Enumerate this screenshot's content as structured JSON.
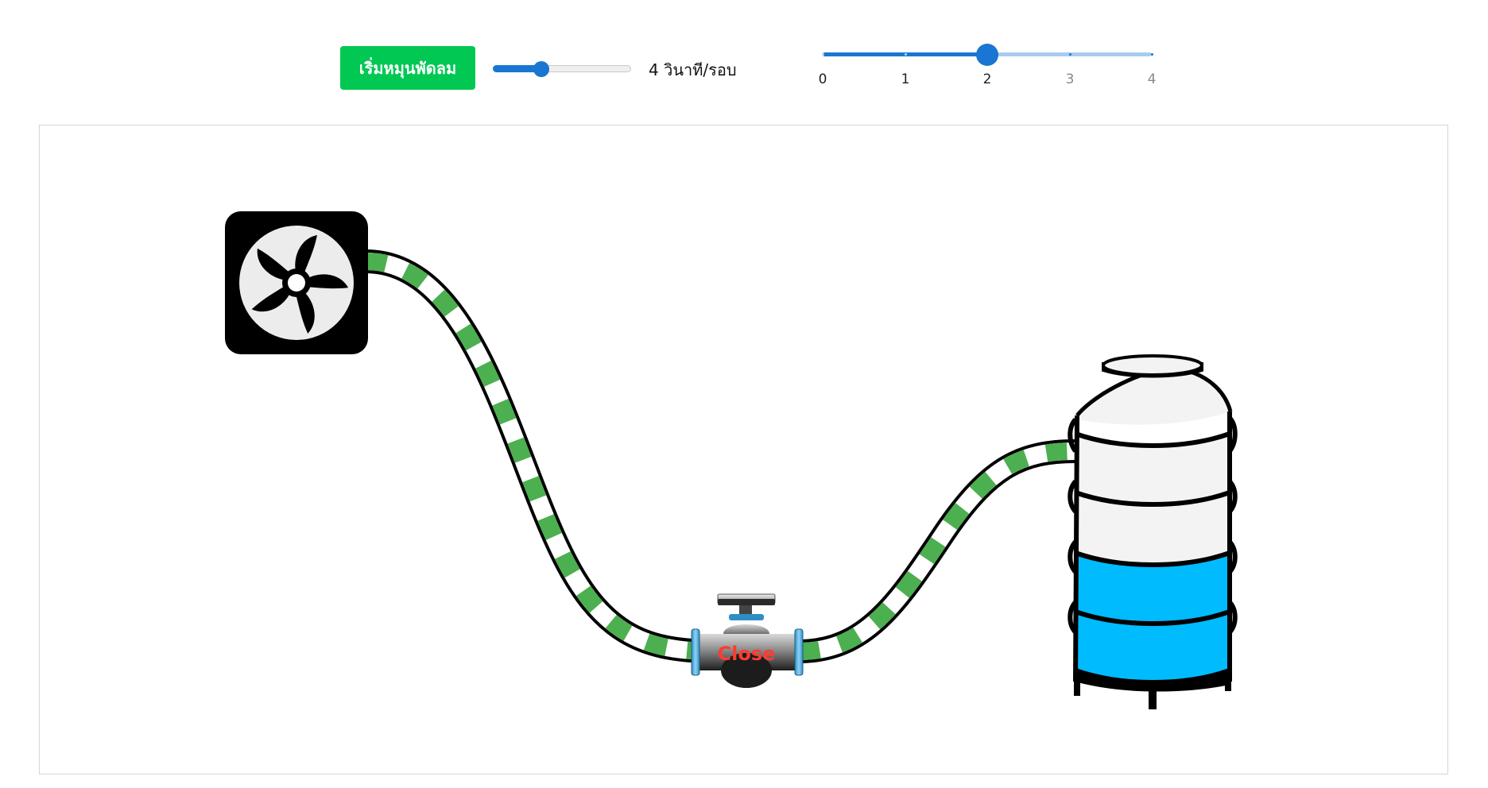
{
  "controls": {
    "start_button_label": "เริ่มหมุนพัดลม",
    "speed_label": "4 วินาที/รอบ",
    "speed_level": 0.35,
    "step_slider": {
      "marks": [
        "0",
        "1",
        "2",
        "3",
        "4"
      ],
      "value": 2,
      "min": 0,
      "max": 4
    }
  },
  "scene": {
    "valve": {
      "state_label": "Close"
    },
    "tank": {
      "water_level_fraction": 0.5
    },
    "icons": [
      "fan-icon",
      "valve-icon",
      "water-tank-icon"
    ]
  },
  "colors": {
    "start_button": "#00c853",
    "slider_accent": "#1976d2",
    "slider_rail": "#a9cbef",
    "pipe_stripe": "#4caf50",
    "pipe_outline": "#000000",
    "water": "#00bbfe",
    "tank_body": "#f3f3f3",
    "valve_label": "#ff3b30",
    "fan_box": "#000000",
    "fan_blade_bg": "#ececec",
    "mark_inactive_text": "#888888",
    "mark_active_text": "#222222"
  }
}
